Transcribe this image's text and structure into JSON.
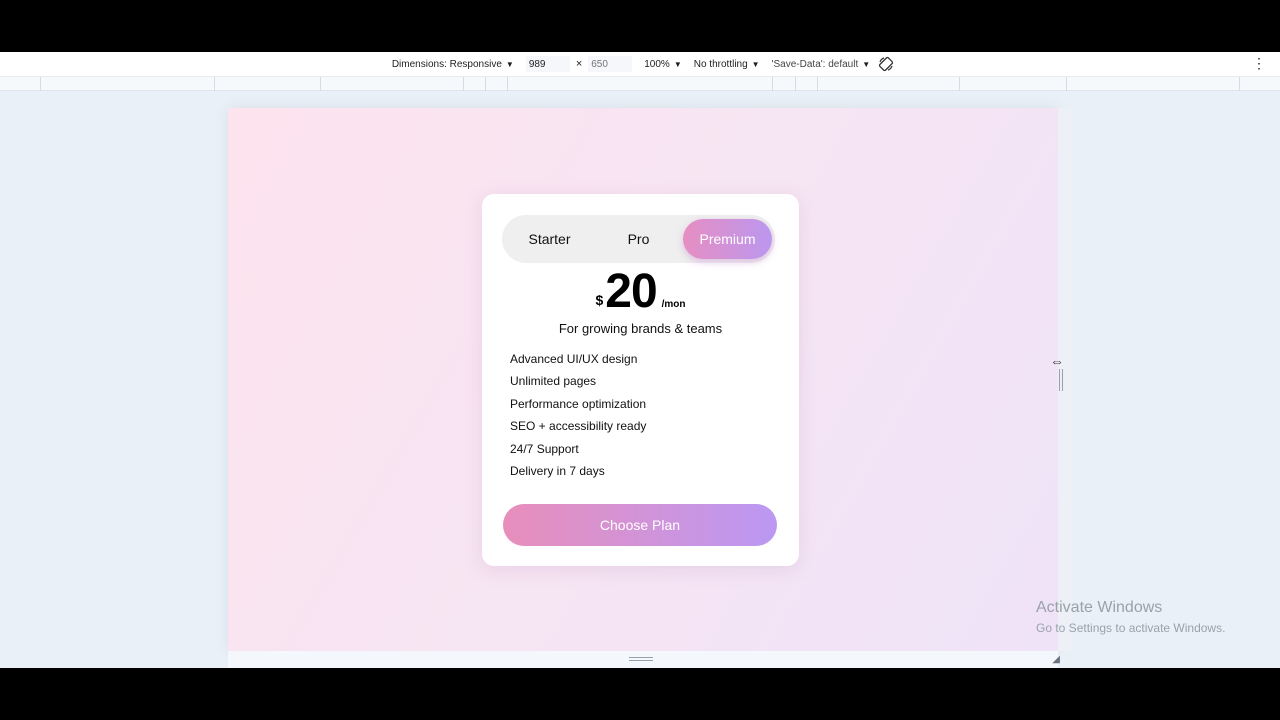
{
  "devtools": {
    "dimensions_label": "Dimensions: Responsive",
    "width_value": "989",
    "height_placeholder": "650",
    "times": "×",
    "zoom": "100%",
    "throttling": "No throttling",
    "save_data": "'Save-Data': default",
    "menu_glyph": "⋮"
  },
  "pricing": {
    "tabs": [
      {
        "label": "Starter"
      },
      {
        "label": "Pro"
      },
      {
        "label": "Premium",
        "active": true
      }
    ],
    "currency": "$",
    "amount": "20",
    "period": "/mon",
    "tagline": "For growing brands & teams",
    "features": [
      "Advanced UI/UX design",
      "Unlimited pages",
      "Performance optimization",
      "SEO + accessibility ready",
      "24/7 Support",
      "Delivery in 7 days"
    ],
    "cta": "Choose Plan"
  },
  "watermark": {
    "title": "Activate Windows",
    "subtitle": "Go to Settings to activate Windows."
  },
  "colors": {
    "accent_start": "#e68ec2",
    "accent_end": "#bb97ef",
    "page_bg_start": "#fde3ee",
    "page_bg_end": "#efe3f8"
  }
}
